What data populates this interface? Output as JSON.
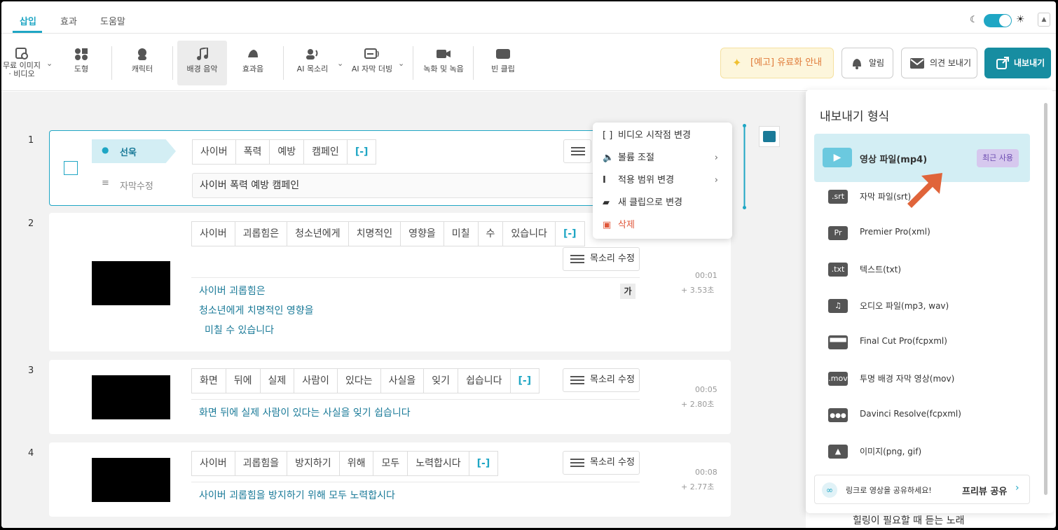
{
  "tabs": [
    {
      "label": "삽입"
    },
    {
      "label": "효과"
    },
    {
      "label": "도움말"
    }
  ],
  "toolbar": {
    "items": [
      {
        "label": "무료 이미지\n· 비디오"
      },
      {
        "label": "도형"
      },
      {
        "label": "캐릭터"
      },
      {
        "label": "배경 음악"
      },
      {
        "label": "효과음"
      },
      {
        "label": "AI 목소리"
      },
      {
        "label": "AI 자막 더빙"
      },
      {
        "label": "녹화 및 녹음"
      },
      {
        "label": "빈 클립"
      }
    ],
    "upgrade": "[예고] 유료화 안내",
    "alarm": "알림",
    "feedback": "의견 보내기",
    "export": "내보내기"
  },
  "clips": [
    {
      "num": "1",
      "speaker": "선욱",
      "subtitle_edit": "자막수정",
      "words": [
        "사이버",
        "폭력",
        "예방",
        "캠페인",
        "[-]"
      ],
      "subtitle": "사이버 폭력 예방 캠페인"
    },
    {
      "num": "2",
      "words": [
        "사이버",
        "괴롭힘은",
        "청소년에게",
        "치명적인",
        "영향을",
        "미칠",
        "수",
        "있습니다",
        "[-]"
      ],
      "voice": "목소리 수정",
      "time": "00:01",
      "dur": "+ 3.53초",
      "lines": [
        "사이버 괴롭힘은",
        "청소년에게 치명적인 영향을",
        "미칠 수 있습니다"
      ],
      "ga": "가"
    },
    {
      "num": "3",
      "words": [
        "화면",
        "뒤에",
        "실제",
        "사람이",
        "있다는",
        "사실을",
        "잊기",
        "쉽습니다",
        "[-]"
      ],
      "voice": "목소리 수정",
      "time": "00:05",
      "dur": "+ 2.80초",
      "lines": [
        "화면 뒤에 실제 사람이 있다는 사실을 잊기 쉽습니다"
      ]
    },
    {
      "num": "4",
      "words": [
        "사이버",
        "괴롭힘을",
        "방지하기",
        "위해",
        "모두",
        "노력합시다",
        "[-]"
      ],
      "voice": "목소리 수정",
      "time": "00:08",
      "dur": "+ 2.77초",
      "lines": [
        "사이버 괴롭힘을 방지하기 위해 모두 노력합시다"
      ]
    }
  ],
  "context_menu": {
    "items": [
      {
        "label": "비디오 시작점 변경"
      },
      {
        "label": "볼륨 조절"
      },
      {
        "label": "적용 범위 변경"
      },
      {
        "label": "새 클립으로 변경"
      },
      {
        "label": "삭제"
      }
    ]
  },
  "export_panel": {
    "title": "내보내기 형식",
    "formats": [
      {
        "icon": "",
        "label": "영상 파일(mp4)",
        "badge": "최근 사용"
      },
      {
        "icon": ".srt",
        "label": "자막 파일(srt)"
      },
      {
        "icon": "Pr",
        "label": "Premier Pro(xml)"
      },
      {
        "icon": ".txt",
        "label": "텍스트(txt)"
      },
      {
        "icon": "♫",
        "label": "오디오 파일(mp3, wav)"
      },
      {
        "icon": "",
        "label": "Final Cut Pro(fcpxml)"
      },
      {
        "icon": ".mov",
        "label": "투명 배경 자막 영상(mov)"
      },
      {
        "icon": "",
        "label": "Davinci Resolve(fcpxml)"
      },
      {
        "icon": "",
        "label": "이미지(png, gif)"
      }
    ],
    "share_text": "링크로 영상을 공유하세요!",
    "share_button": "프리뷰 공유"
  },
  "bottom_text": "힐링이 필요할 때 듣는 노래"
}
